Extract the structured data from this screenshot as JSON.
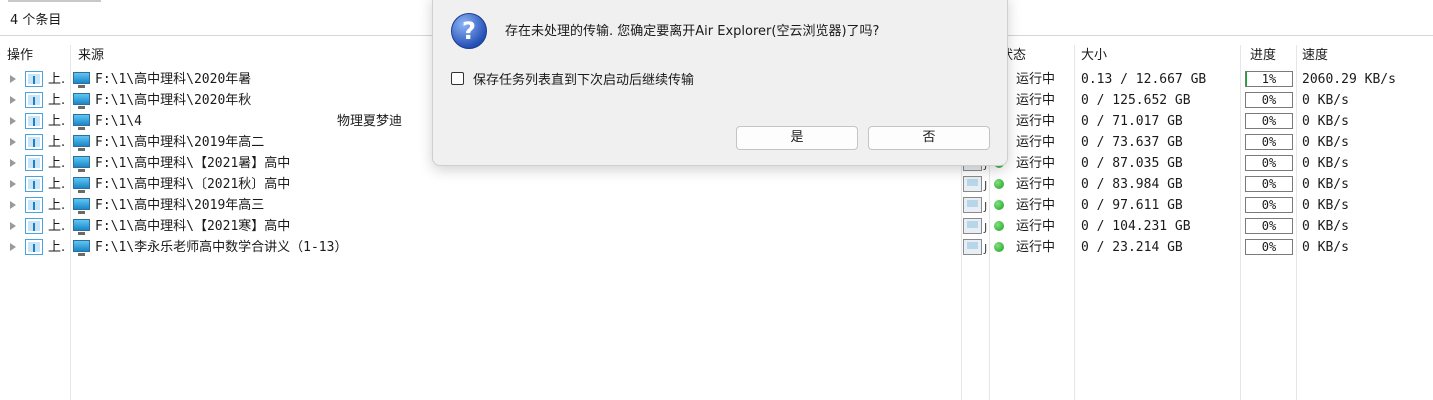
{
  "toolbar": {
    "item_count": "4 个条目"
  },
  "columns": {
    "operation": "操作",
    "source": "来源",
    "status": "状态",
    "size": "大小",
    "progress": "进度",
    "speed": "速度"
  },
  "rows": [
    {
      "op": "上.",
      "source": "F:\\1\\高中理科\\2020年暑",
      "extra": "",
      "status": "运行中",
      "size": "0.13 / 12.667 GB",
      "progress_label": "1%",
      "progress_value": 1,
      "speed": "2060.29 KB/s"
    },
    {
      "op": "上.",
      "source": "F:\\1\\高中理科\\2020年秋",
      "extra": "",
      "status": "运行中",
      "size": "0 / 125.652 GB",
      "progress_label": "0%",
      "progress_value": 0,
      "speed": "0 KB/s"
    },
    {
      "op": "上.",
      "source": "F:\\1\\4",
      "extra": "物理夏梦迪",
      "status": "运行中",
      "size": "0 / 71.017 GB",
      "progress_label": "0%",
      "progress_value": 0,
      "speed": "0 KB/s"
    },
    {
      "op": "上.",
      "source": "F:\\1\\高中理科\\2019年高二",
      "extra": "",
      "status": "运行中",
      "size": "0 / 73.637 GB",
      "progress_label": "0%",
      "progress_value": 0,
      "speed": "0 KB/s"
    },
    {
      "op": "上.",
      "source": "F:\\1\\高中理科\\【2021暑】高中",
      "extra": "",
      "status": "运行中",
      "size": "0 / 87.035 GB",
      "progress_label": "0%",
      "progress_value": 0,
      "speed": "0 KB/s"
    },
    {
      "op": "上.",
      "source": "F:\\1\\高中理科\\〔2021秋〕高中",
      "extra": "",
      "status": "运行中",
      "size": "0 / 83.984 GB",
      "progress_label": "0%",
      "progress_value": 0,
      "speed": "0 KB/s"
    },
    {
      "op": "上.",
      "source": "F:\\1\\高中理科\\2019年高三",
      "extra": "",
      "status": "运行中",
      "size": "0 / 97.611 GB",
      "progress_label": "0%",
      "progress_value": 0,
      "speed": "0 KB/s"
    },
    {
      "op": "上.",
      "source": "F:\\1\\高中理科\\【2021寒】高中",
      "extra": "",
      "status": "运行中",
      "size": "0 / 104.231 GB",
      "progress_label": "0%",
      "progress_value": 0,
      "speed": "0 KB/s"
    },
    {
      "op": "上.",
      "source": "F:\\1\\李永乐老师高中数学合讲义（1-13）",
      "extra": "",
      "status": "运行中",
      "size": "0 / 23.214 GB",
      "progress_label": "0%",
      "progress_value": 0,
      "speed": "0 KB/s"
    }
  ],
  "dialog": {
    "message": "存在未处理的传输. 您确定要离开Air Explorer(空云浏览器)了吗?",
    "checkbox_label": "保存任务列表直到下次启动后继续传输",
    "checkbox_checked": false,
    "yes_label": "是",
    "no_label": "否",
    "icon": "question-icon"
  },
  "colors": {
    "progress_fill": "#06b025",
    "status_running": "#1e9e1e",
    "accent": "#2652b8"
  }
}
